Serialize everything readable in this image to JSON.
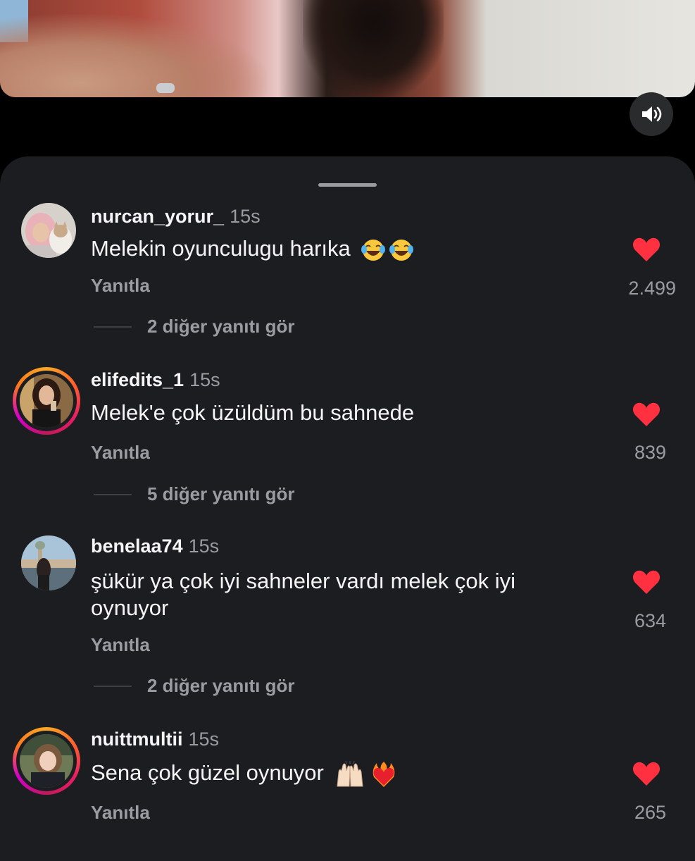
{
  "video": {
    "mute_icon": "speaker-icon"
  },
  "comments": [
    {
      "username": "nurcan_yorur_",
      "time": "15s",
      "text": "Melekin oyunculugu harıka",
      "emojis": [
        "😂",
        "😂"
      ],
      "reply": "Yanıtla",
      "likes": "2.499",
      "more_replies": "2 diğer yanıtı gör",
      "has_story_ring": false
    },
    {
      "username": "elifedits_1",
      "time": "15s",
      "text": "Melek'e çok üzüldüm bu sahnede",
      "emojis": [],
      "reply": "Yanıtla",
      "likes": "839",
      "more_replies": "5 diğer yanıtı gör",
      "has_story_ring": true
    },
    {
      "username": "benelaa74",
      "time": "15s",
      "text": "şükür ya çok iyi sahneler vardı melek çok iyi oynuyor",
      "emojis": [],
      "reply": "Yanıtla",
      "likes": "634",
      "more_replies": "2 diğer yanıtı gör",
      "has_story_ring": false
    },
    {
      "username": "nuittmultii",
      "time": "15s",
      "text": "Sena çok güzel oynuyor",
      "emojis": [
        "🙌🏻",
        "❤️‍🔥"
      ],
      "reply": "Yanıtla",
      "likes": "265",
      "has_story_ring": true
    }
  ],
  "colors": {
    "sheet_bg": "#1c1d21",
    "heart": "#ff3040",
    "muted_text": "#9a9ca1"
  }
}
